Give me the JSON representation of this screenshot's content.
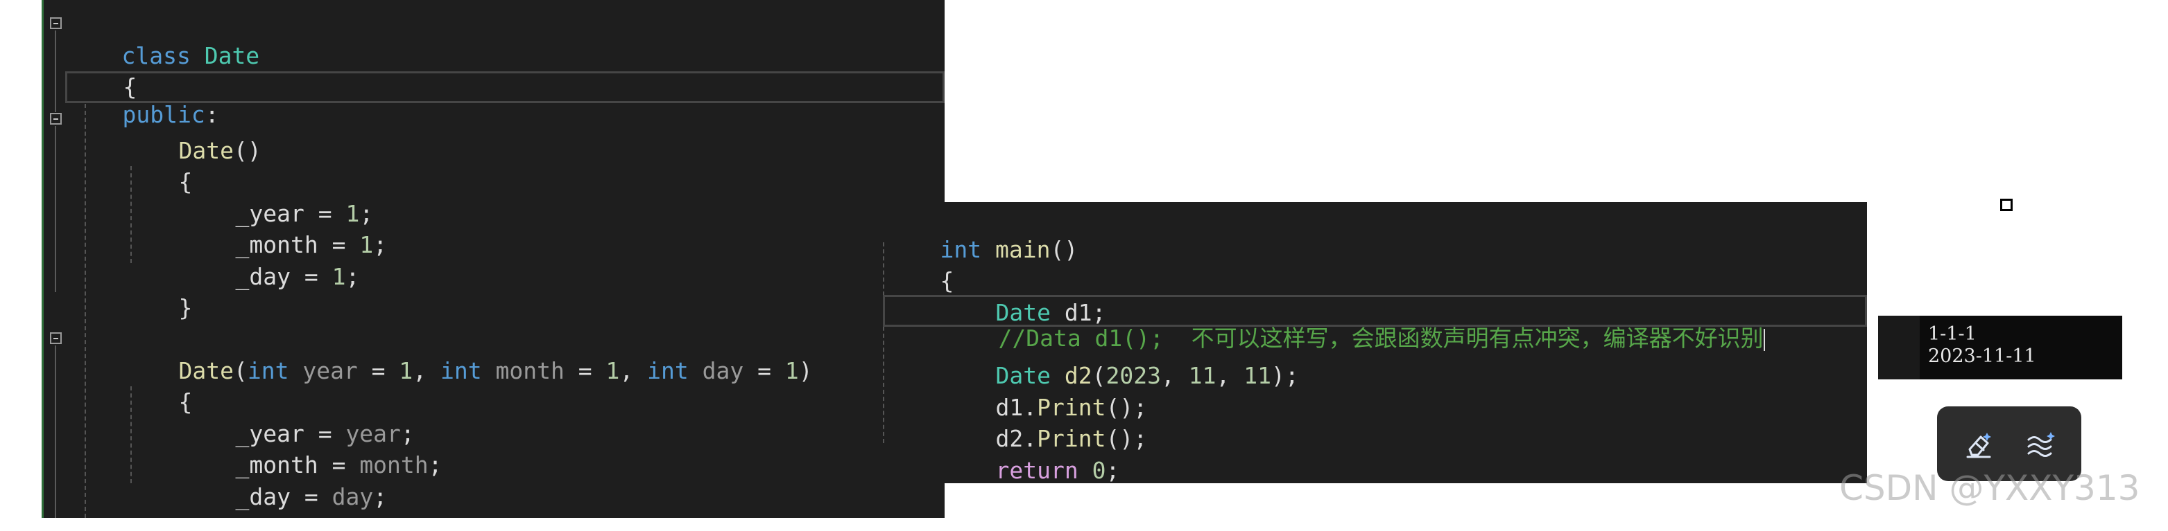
{
  "left_code": {
    "lines": {
      "l1": {
        "kw": "class",
        "name": "Date"
      },
      "l2": {
        "brace": "{"
      },
      "l3": {
        "kw": "public",
        "colon": ":"
      },
      "l4": {
        "fn": "Date",
        "paren": "()"
      },
      "l5": {
        "brace": "{"
      },
      "l6": {
        "var": "_year",
        "op": " = ",
        "num": "1",
        "end": ";"
      },
      "l7": {
        "var": "_month",
        "op": " = ",
        "num": "1",
        "end": ";"
      },
      "l8": {
        "var": "_day",
        "op": " = ",
        "num": "1",
        "end": ";"
      },
      "l9": {
        "brace": "}"
      },
      "l10": {
        "fn": "Date",
        "open": "(",
        "t1": "int",
        "p1": "year",
        "eq1": " = ",
        "v1": "1",
        "c1": ", ",
        "t2": "int",
        "p2": "month",
        "eq2": " = ",
        "v2": "1",
        "c2": ", ",
        "t3": "int",
        "p3": "day",
        "eq3": " = ",
        "v3": "1",
        "close": ")"
      },
      "l11": {
        "brace": "{"
      },
      "l12": {
        "var": "_year",
        "op": " = ",
        "param": "year",
        "end": ";"
      },
      "l13": {
        "var": "_month",
        "op": " = ",
        "param": "month",
        "end": ";"
      },
      "l14": {
        "var": "_day",
        "op": " = ",
        "param": "day",
        "end": ";"
      },
      "l15": {
        "brace": "}"
      }
    }
  },
  "right_code": {
    "lines": {
      "r1": {
        "kw": "int",
        "fn": "main",
        "paren": "()"
      },
      "r2": {
        "brace": "{"
      },
      "r3": {
        "type": "Date",
        "var": "d1",
        "end": ";"
      },
      "r4": {
        "comment": "//Data d1();  不可以这样写，会跟函数声明有点冲突，编译器不好识别"
      },
      "r5": {
        "type": "Date",
        "var": "d2",
        "open": "(",
        "a1": "2023",
        "s1": ", ",
        "a2": "11",
        "s2": ", ",
        "a3": "11",
        "close": ");"
      },
      "r6": {
        "var": "d1",
        "dot": ".",
        "fn": "Print",
        "tail": "();"
      },
      "r7": {
        "var": "d2",
        "dot": ".",
        "fn": "Print",
        "tail": "();"
      },
      "r8": {
        "kw": "return",
        "num": "0",
        "end": ";"
      },
      "r9": {
        "brace": "}"
      }
    }
  },
  "console": {
    "lines": [
      "1-1-1",
      "2023-11-11"
    ]
  },
  "toolbar": {
    "icons": [
      "eraser-icon",
      "clear-strokes-icon"
    ]
  },
  "watermark": "CSDN @YXXY313",
  "colors": {
    "keyword": "#569cd6",
    "type": "#4ec9b0",
    "function": "#dcdcaa",
    "number": "#b5cea8",
    "comment": "#57a64a",
    "control": "#d8a0df",
    "background": "#1e1e1e"
  }
}
